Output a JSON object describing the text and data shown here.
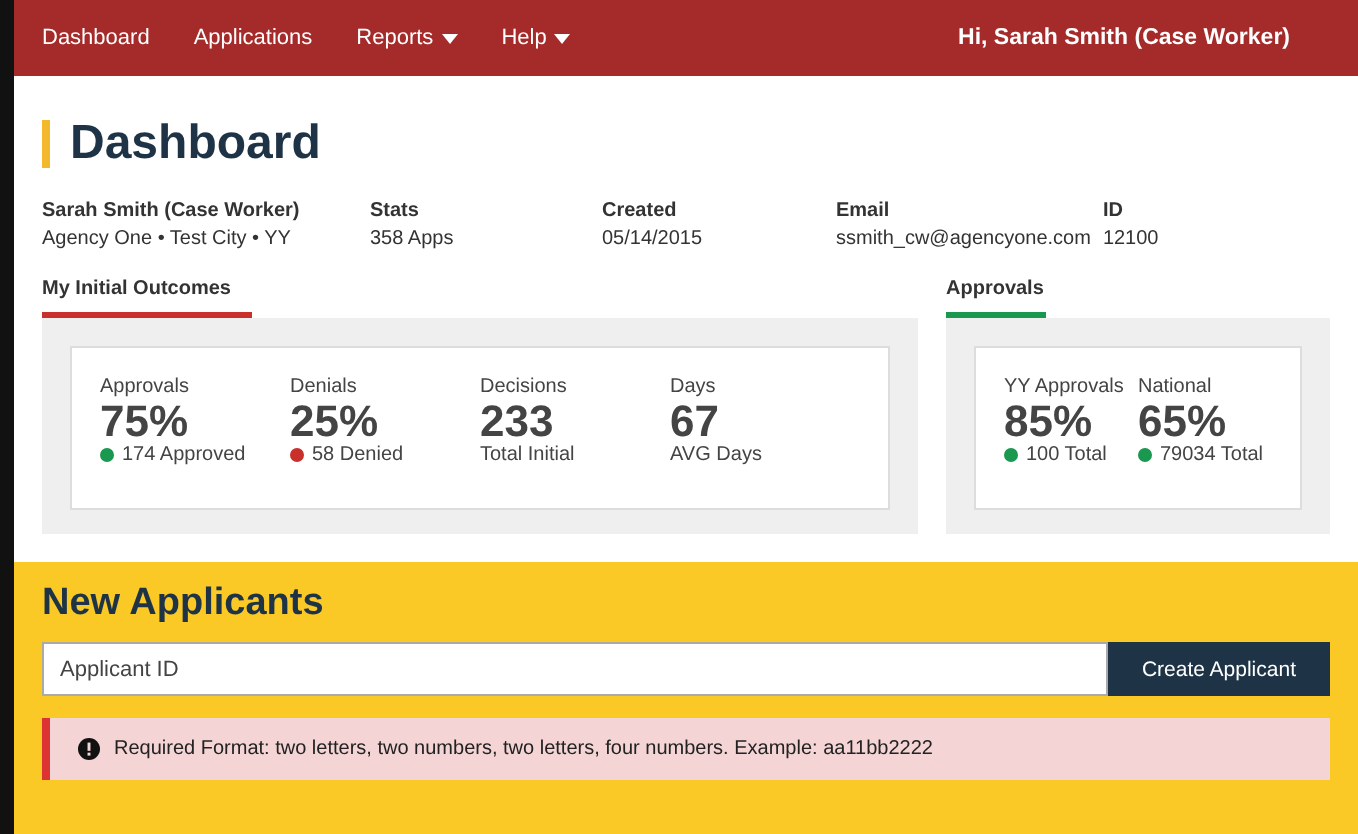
{
  "nav": {
    "items": [
      {
        "label": "Dashboard",
        "dropdown": false
      },
      {
        "label": "Applications",
        "dropdown": false
      },
      {
        "label": "Reports",
        "dropdown": true
      },
      {
        "label": "Help",
        "dropdown": true
      }
    ],
    "user": "Hi, Sarah Smith (Case Worker)"
  },
  "title": "Dashboard",
  "info": [
    {
      "label": "Sarah Smith (Case Worker)",
      "value": "Agency One • Test City • YY"
    },
    {
      "label": "Stats",
      "value": "358 Apps"
    },
    {
      "label": "Created",
      "value": "05/14/2015"
    },
    {
      "label": "Email",
      "value": "ssmith_cw@agencyone.com"
    },
    {
      "label": "ID",
      "value": "12100"
    }
  ],
  "sections": [
    {
      "title": "My Initial Outcomes",
      "color": "#c9302c",
      "stats": [
        {
          "label": "Approvals",
          "value": "75%",
          "sub": "174 Approved",
          "color": "#1a9850"
        },
        {
          "label": "Denials",
          "value": "25%",
          "sub": "58 Denied",
          "color": "#c9302c"
        },
        {
          "label": "Decisions",
          "value": "233",
          "sub": "Total Initial"
        },
        {
          "label": "Days",
          "value": "67",
          "sub": "AVG Days"
        }
      ]
    },
    {
      "title": "Approvals",
      "color": "#1a9850",
      "stats": [
        {
          "label": "YY Approvals",
          "value": "85%",
          "sub": "100 Total",
          "color": "#1a9850"
        },
        {
          "label": "National",
          "value": "65%",
          "sub": "79034 Total",
          "color": "#1a9850"
        }
      ]
    }
  ],
  "new_applicants": {
    "title": "New Applicants",
    "placeholder": "Applicant ID",
    "button": "Create Applicant",
    "alert": "Required Format: two letters, two numbers, two letters, four numbers. Example: aa11bb2222"
  }
}
